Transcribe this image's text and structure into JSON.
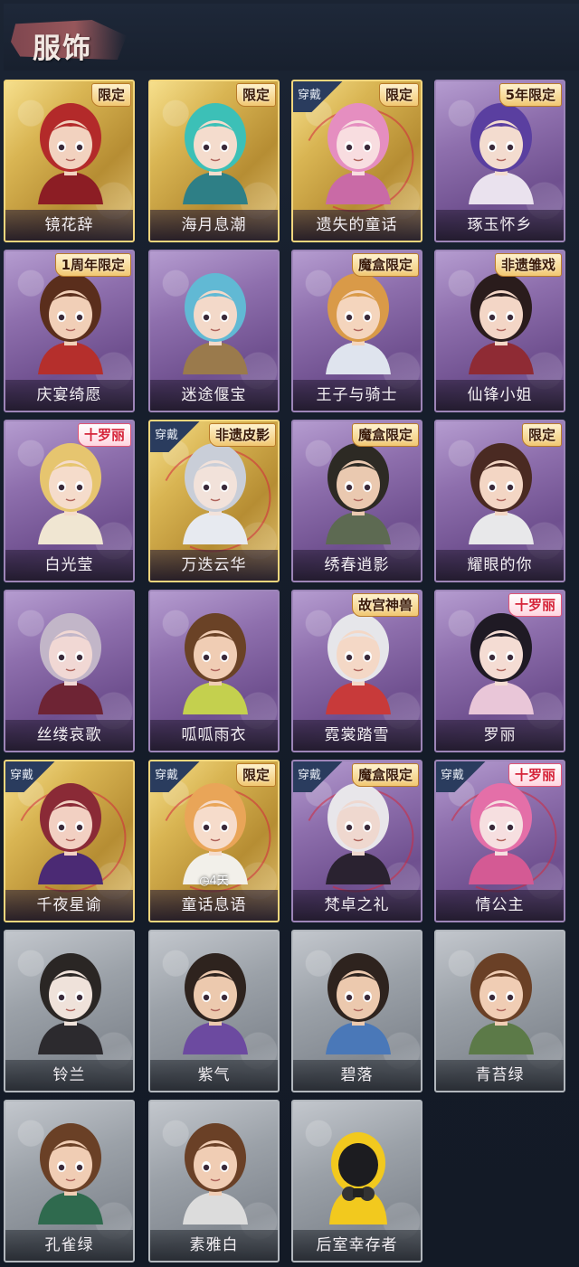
{
  "header": {
    "title": "服饰"
  },
  "outfits": [
    {
      "name": "镜花辞",
      "rarity": "gold",
      "badge": "限定",
      "badge_style": "gold",
      "worn": false,
      "hair": "#b32a2a",
      "skin": "#f2d2bf",
      "outfit": "#8c1d24"
    },
    {
      "name": "海月息潮",
      "rarity": "gold",
      "badge": "限定",
      "badge_style": "gold",
      "worn": false,
      "hair": "#3cc0b7",
      "skin": "#f4dccd",
      "outfit": "#2e7f86"
    },
    {
      "name": "遗失的童话",
      "rarity": "gold",
      "badge": "限定",
      "badge_style": "gold",
      "worn": true,
      "hair": "#e58ec0",
      "skin": "#f8dde0",
      "outfit": "#c96aa6"
    },
    {
      "name": "琢玉怀乡",
      "rarity": "purple",
      "badge": "5年限定",
      "badge_style": "gold",
      "worn": false,
      "hair": "#5a3fa0",
      "skin": "#f3dccf",
      "outfit": "#eae2ee"
    },
    {
      "name": "庆宴绮愿",
      "rarity": "purple",
      "badge": "1周年限定",
      "badge_style": "gold",
      "worn": false,
      "hair": "#5a2e1c",
      "skin": "#f1cfb7",
      "outfit": "#b52f2c"
    },
    {
      "name": "迷途偃宝",
      "rarity": "purple",
      "badge": "",
      "badge_style": "",
      "worn": false,
      "hair": "#61b9d4",
      "skin": "#f3d9c9",
      "outfit": "#9a7a4c"
    },
    {
      "name": "王子与骑士",
      "rarity": "purple",
      "badge": "魔盒限定",
      "badge_style": "gold",
      "worn": false,
      "hair": "#d99a48",
      "skin": "#f4d5bd",
      "outfit": "#dfe4ee"
    },
    {
      "name": "仙锋小姐",
      "rarity": "purple",
      "badge": "非遗雏戏",
      "badge_style": "gold",
      "worn": false,
      "hair": "#2a1c1c",
      "skin": "#f3d6c6",
      "outfit": "#8f2b34"
    },
    {
      "name": "白光莹",
      "rarity": "purple",
      "badge": "十罗丽",
      "badge_style": "red",
      "worn": false,
      "hair": "#e6c56f",
      "skin": "#f5dccb",
      "outfit": "#f0e6d2"
    },
    {
      "name": "万迭云华",
      "rarity": "gold",
      "badge": "非遗皮影",
      "badge_style": "gold",
      "worn": true,
      "hair": "#c9ced8",
      "skin": "#f2e2da",
      "outfit": "#e7eaf0"
    },
    {
      "name": "绣春逍影",
      "rarity": "purple",
      "badge": "魔盒限定",
      "badge_style": "gold",
      "worn": false,
      "hair": "#2d2a24",
      "skin": "#eac9b0",
      "outfit": "#5d6a52"
    },
    {
      "name": "耀眼的你",
      "rarity": "purple",
      "badge": "限定",
      "badge_style": "gold",
      "worn": false,
      "hair": "#4a2a22",
      "skin": "#f3d6c4",
      "outfit": "#e8e8ea"
    },
    {
      "name": "丝缕哀歌",
      "rarity": "purple",
      "badge": "",
      "badge_style": "",
      "worn": false,
      "hair": "#c2b6c8",
      "skin": "#f1d8d4",
      "outfit": "#6e2434"
    },
    {
      "name": "呱呱雨衣",
      "rarity": "purple",
      "badge": "",
      "badge_style": "",
      "worn": false,
      "hair": "#6a4226",
      "skin": "#f0cdb4",
      "outfit": "#c4d04e"
    },
    {
      "name": "霓裳踏雪",
      "rarity": "purple",
      "badge": "故宫神兽",
      "badge_style": "gold",
      "worn": false,
      "hair": "#e6e6ea",
      "skin": "#f4d8c6",
      "outfit": "#c83a3a"
    },
    {
      "name": "罗丽",
      "rarity": "purple",
      "badge": "十罗丽",
      "badge_style": "red",
      "worn": false,
      "hair": "#1f1a24",
      "skin": "#f4dcd3",
      "outfit": "#e9c6d8"
    },
    {
      "name": "千夜星谕",
      "rarity": "gold",
      "badge": "",
      "badge_style": "",
      "worn": true,
      "hair": "#8a2a36",
      "skin": "#f2d0c2",
      "outfit": "#4b2a74"
    },
    {
      "name": "童话息语",
      "rarity": "gold",
      "badge": "限定",
      "badge_style": "gold",
      "worn": true,
      "hair": "#e9a558",
      "skin": "#f6dccb",
      "outfit": "#f2f0ea",
      "timer": "◷4天"
    },
    {
      "name": "梵卓之礼",
      "rarity": "purple",
      "badge": "魔盒限定",
      "badge_style": "gold",
      "worn": true,
      "hair": "#e8e6ea",
      "skin": "#efd8cf",
      "outfit": "#2a2230"
    },
    {
      "name": "情公主",
      "rarity": "purple",
      "badge": "十罗丽",
      "badge_style": "red",
      "worn": true,
      "hair": "#e46fa8",
      "skin": "#f6dfe0",
      "outfit": "#d45a94"
    },
    {
      "name": "铃兰",
      "rarity": "gray",
      "badge": "",
      "badge_style": "",
      "worn": false,
      "hair": "#2a2624",
      "skin": "#efe2da",
      "outfit": "#2c2a2e"
    },
    {
      "name": "紫气",
      "rarity": "gray",
      "badge": "",
      "badge_style": "",
      "worn": false,
      "hair": "#2e231e",
      "skin": "#ecc9ae",
      "outfit": "#6c4aa0"
    },
    {
      "name": "碧落",
      "rarity": "gray",
      "badge": "",
      "badge_style": "",
      "worn": false,
      "hair": "#2e231e",
      "skin": "#ecc9ae",
      "outfit": "#4a78b8"
    },
    {
      "name": "青苔绿",
      "rarity": "gray",
      "badge": "",
      "badge_style": "",
      "worn": false,
      "hair": "#6a4026",
      "skin": "#f0cdb4",
      "outfit": "#5c7a48"
    },
    {
      "name": "孔雀绿",
      "rarity": "gray",
      "badge": "",
      "badge_style": "",
      "worn": false,
      "hair": "#6a4026",
      "skin": "#f0cdb4",
      "outfit": "#2f6a4e"
    },
    {
      "name": "素雅白",
      "rarity": "gray",
      "badge": "",
      "badge_style": "",
      "worn": false,
      "hair": "#6a4026",
      "skin": "#f0cdb4",
      "outfit": "#dcdcdc"
    },
    {
      "name": "后室幸存者",
      "rarity": "gray",
      "badge": "",
      "badge_style": "",
      "worn": false,
      "hair": "#f2c91e",
      "skin": "#1c1c20",
      "outfit": "#f2c91e"
    }
  ],
  "wear_label": "穿戴"
}
